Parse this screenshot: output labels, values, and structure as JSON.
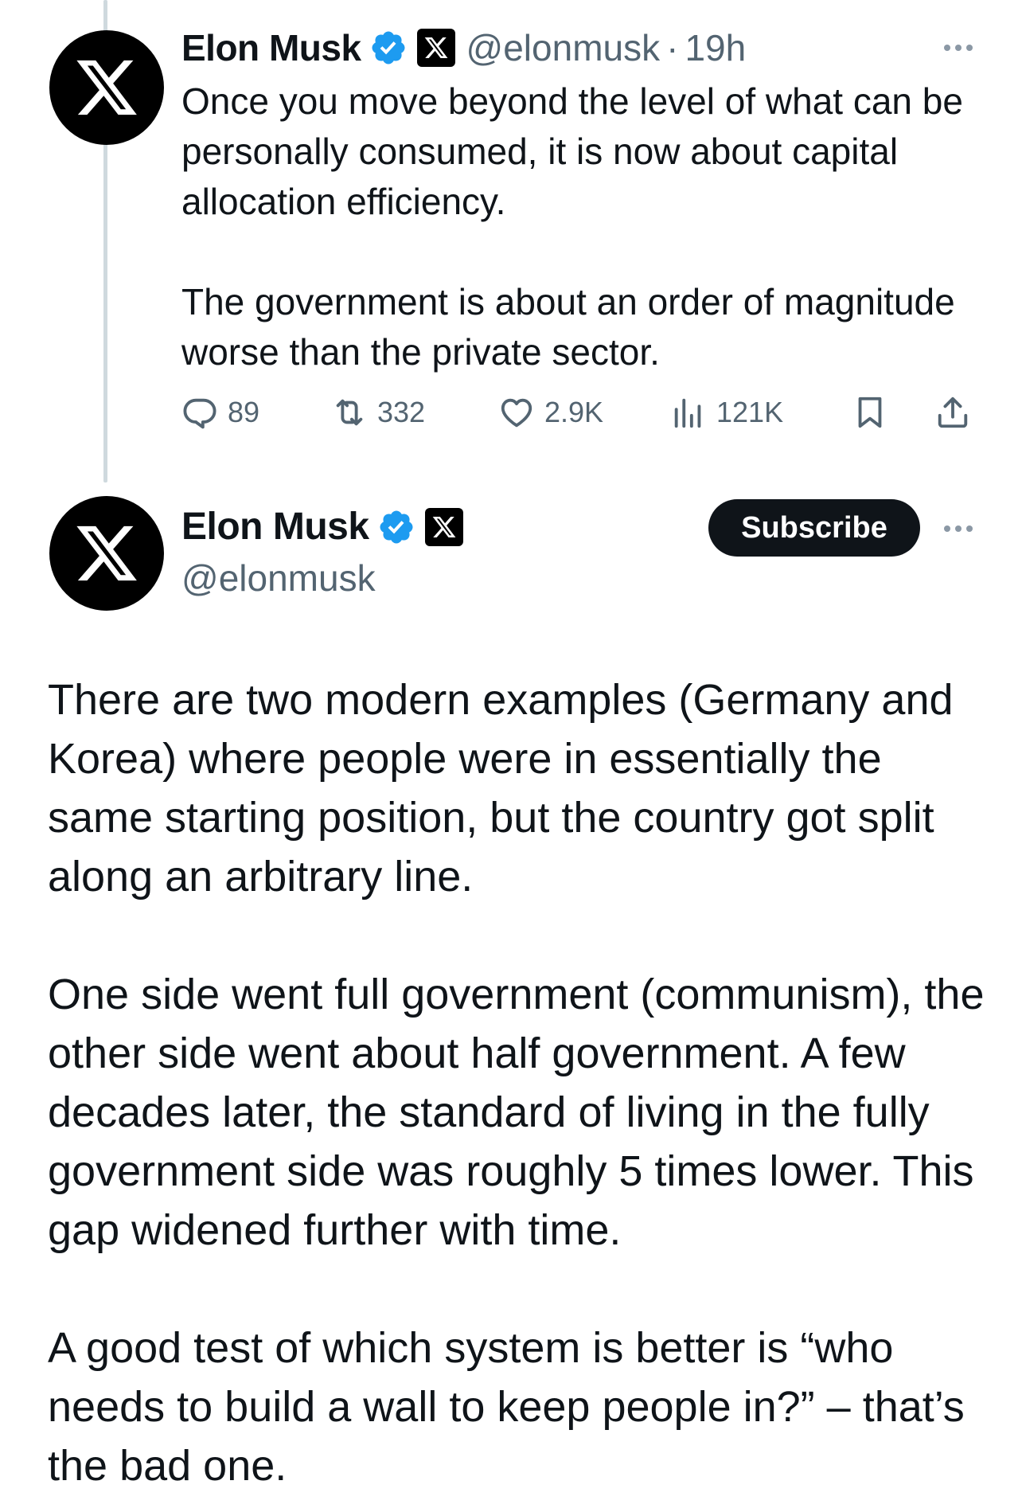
{
  "reply_tweet": {
    "author_name": "Elon Musk",
    "handle": "@elonmusk",
    "separator": "·",
    "time": "19h",
    "paragraphs": [
      "Once you move beyond the level of what can be personally consumed, it is now about capital allocation efficiency.",
      "The government is about an order of magnitude worse than the private sector."
    ],
    "stats": {
      "replies": "89",
      "reposts": "332",
      "likes": "2.9K",
      "views": "121K"
    }
  },
  "main_tweet": {
    "author_name": "Elon Musk",
    "handle": "@elonmusk",
    "subscribe_label": "Subscribe",
    "paragraphs": [
      "There are two modern examples (Germany and Korea) where people were in essentially the same starting position, but the country got split along an arbitrary line.",
      "One side went full government (communism), the other side went  about half government. A few decades later, the standard of living in the fully government side was roughly 5 times lower. This gap widened further with time.",
      "A good test of which system is better is “who needs to build a wall to keep people in?” – that’s the bad one."
    ]
  },
  "icons": {
    "avatar": "x-logo-icon",
    "verified": "verified-badge-icon",
    "affiliation": "x-badge-icon",
    "reply": "reply-icon",
    "repost": "repost-icon",
    "like": "heart-icon",
    "views": "views-chart-icon",
    "bookmark": "bookmark-icon",
    "share": "share-icon",
    "more": "more-dots-icon"
  },
  "colors": {
    "verified_blue": "#1d9bf0",
    "text_primary": "#0f1419",
    "text_secondary": "#536471",
    "thread_line": "#cfd9de"
  }
}
